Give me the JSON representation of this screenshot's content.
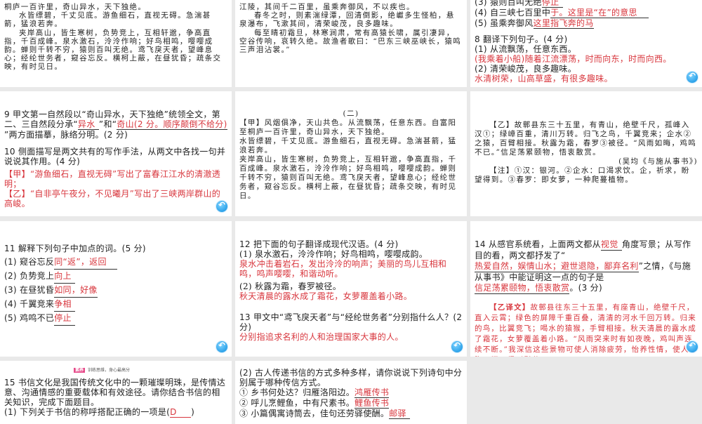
{
  "tile1": {
    "lines": [
      "桐庐一百许里，奇山异水，天下独绝。",
      "水皆缥碧，千丈见底。游鱼细石，直视无碍。急湍甚箭，猛浪若奔。",
      "夹岸高山，皆生寒树，负势竞上，互相轩邈，争高直指，千百成峰。泉水激石，泠泠作响；好鸟相鸣，嘤嘤成韵。蝉则千转不穷，猿则百叫无绝。鸢飞戾天者，望峰息心；经纶世务者，窥谷忘反。横柯上蔽，在昼犹昏；疏条交映，有时见日。"
    ]
  },
  "tile2": {
    "lines": [
      "江陵，其间千二百里，虽乘奔御风，不以疾也。",
      "春冬之时，则素湍绿潭，回清倒影，绝巘多生怪柏，悬泉瀑布，飞漱其间，清荣峻茂，良多趣味。",
      "每至晴初霜旦，林寒涧肃，常有高猿长啸，属引凄异，空谷传响，哀转久绝。故渔者歌曰：“巴东三峡巫峡长，猿鸣三声泪沾裳。”"
    ]
  },
  "tile3": {
    "items": [
      {
        "q": "(3) 猿则百叫无绝",
        "a": "停止"
      },
      {
        "q": "(4) 自三峡七百里中",
        "a": "于。这里是“在”的意思"
      },
      {
        "q": "(5) 虽乘奔御风",
        "a": "这里指飞奔的马"
      }
    ],
    "q8": "8 翻译下列句子。(4 分)",
    "s1": "(1) 从流飘荡，任意东西。",
    "a1": "(我乘着小船)随着江流漂荡，时而向东，时而向西。",
    "s2": "(2) 清荣峻茂，良多趣味。",
    "a2": "水清树荣，山高草盛，有很多趣味。"
  },
  "tile4": {
    "q9a": "9 甲文第一自然段以“奇山异水，天下独绝”统领全文，第二、三自然段分承“",
    "ans1": "异水",
    "q9b": "”和“",
    "ans2": "奇山(2 分。顺序颠倒不给分)",
    "q9c": "”两方面描摹，脉络分明。(2 分)",
    "q10": "10 侧面描写是两文共有的写作手法，从两文中各找一句并说说其作用。(4 分)",
    "a1": "【甲】“游鱼细石，直视无碍”写出了富春江江水的清澈透明；",
    "a2": "【乙】“自非亭午夜分，不见曦月”写出了三峡两岸群山的高峻。"
  },
  "tile5": {
    "title": "(二)",
    "lines": [
      "【甲】风烟俱净，天山共色。从流飘荡，任意东西。自富阳至桐庐一百许里，奇山异水，天下独绝。",
      "水皆缥碧，千丈见底。游鱼细石，直视无碍。急湍甚箭，猛浪若奔。",
      "夹岸高山，皆生寒树，负势竞上，互相轩邈，争高直指，千百成峰。泉水激石，泠泠作响；好鸟相鸣，嘤嘤成韵。蝉则千转不穷，猿则百叫无绝。鸢飞戾天者，望峰息心；经纶世务者，窥谷忘反。横柯上蔽，在昼犹昏；疏条交映，有时见日。"
    ]
  },
  "tile6": {
    "text": "【乙】故鄣县东三十五里，有青山，绝壁千尺，孤峰入汉①；绿嶂百重，清川万转。归飞之鸟，千翼竞来；企水②之猿，百臂相接。秋露为霜，春罗③被径。“风雨如晦，鸡鸣不已。”信足荡累颐物，悟衷散赏。",
    "source": "(吴均《与施从事书》)",
    "note": "【注】①汉：银河。②企水：口渴求饮。企，祈求，盼望得到。③春罗：即女萝，一种爬蔓植物。"
  },
  "tile7": {
    "q": "11 解释下列句子中加点的词。(5 分)",
    "items": [
      {
        "q": "(1) 窥谷忘反",
        "a": "同“返”，返回"
      },
      {
        "q": "(2) 负势竞上",
        "a": "向上"
      },
      {
        "q": "(3) 在昼犹昏",
        "a": "如同，好像"
      },
      {
        "q": "(4) 千翼竞来",
        "a": "争相"
      },
      {
        "q": "(5) 鸡鸣不已",
        "a": "停止"
      }
    ]
  },
  "tile8": {
    "q12": "12 把下面的句子翻译成现代汉语。(4 分)",
    "s1": "(1) 泉水激石，泠泠作响；好鸟相鸣，嘤嘤成韵。",
    "a1": "泉水冲击着岩石，发出泠泠的响声；美丽的鸟儿互相和鸣，鸣声嘤嘤，和谐动听。",
    "s2": "(2) 秋露为霜，春罗被径。",
    "a2": "秋天清晨的露水成了霜花，女萝覆盖着小路。",
    "q13": "13 甲文中“鸢飞戾天者”与“经纶世务者”分别指什么人？(2 分)",
    "a13": "分别指追求名利的人和治理国家大事的人。"
  },
  "tile9": {
    "p1": "14 从感官系统看，上面两文都从",
    "b1": "视觉",
    "p2": "角度写景；从写作目的看，两文都抒发了“",
    "b2": "热爱自然，娱情山水；避世退隐，鄙弃名利",
    "p3": "”之情，《与施从事书》中能证明这一点的句子是",
    "b3": "信足荡累颐物，悟衷散赏",
    "p4": "。(3 分)",
    "trans_label": "【乙译文】",
    "trans": "故鄣县往东三十五里，有座青山，绝壁千尺，直入云霄；绿色的屏障千重百叠，清清的河水千回万转。归来的鸟，比翼竞飞；喝水的猿猴，手臂相接。秋天清晨的露水成了霜花，女萝覆盖着小路。“风雨突来时有如夜晚，鸡叫声连续不断。”我深信这些景物可使人消除疲劳，怡养性情，使人心胸开阔，得到慰藉。"
  },
  "tile10": {
    "badge": "素养",
    "badge_sub": "训练思维，身心最高分",
    "q15": "15 书信文化是我国传统文化中的一颗璀璨明珠，是传情达意、沟通情感的重要载体和有效途径。请你结合书信的相关知识，完成下面题目。",
    "s1": "(1) 下列关于书信的称呼搭配正确的一项是(",
    "a1": "D",
    "s1end": ")"
  },
  "tile11": {
    "q": "(2) 古人传递书信的方式多种多样，请你说说下列诗句中分别属于哪种传信方式。",
    "items": [
      {
        "q": "① 乡书何处达？归雁洛阳边。",
        "a": "鸿雁传书"
      },
      {
        "q": "② 呼儿烹鲤鱼，中有尺素书。",
        "a": "鲤鱼传书"
      },
      {
        "q": "③ 小篇偶寓诗筒去，佳句还劳驿使酬。",
        "a": "邮驿"
      }
    ]
  }
}
